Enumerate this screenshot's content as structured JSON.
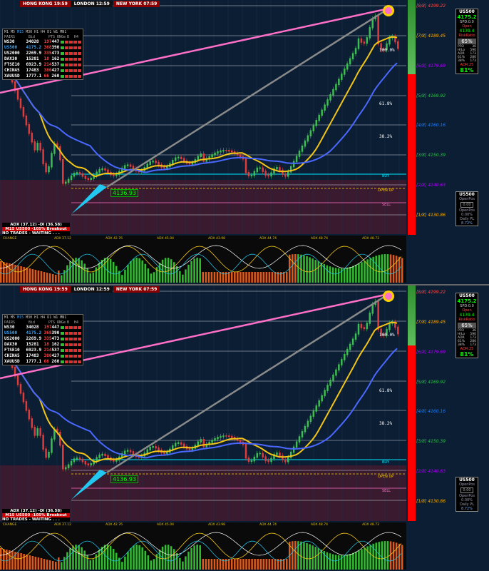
{
  "session_bar": {
    "hong_kong": "HONG KONG 19:59",
    "london": "LONDON 12:59",
    "new_york": "NEW YORK 07:59"
  },
  "quotes_table": {
    "timeframes": [
      "M1",
      "M5",
      "M15",
      "M30",
      "H1",
      "H4",
      "D1",
      "W1",
      "MN1"
    ],
    "headers": {
      "pairs": "PAIRS",
      "bid": "Bid",
      "pts": "PTS",
      "rng": "RNGe",
      "b": "B",
      "h": "H4"
    },
    "rows": [
      {
        "symbol": "WS30",
        "bid": "34028",
        "c1": "197",
        "c2": "447",
        "color": "#ffffff"
      },
      {
        "symbol": "US500",
        "bid": "4175.2",
        "c1": "368",
        "c2": "390",
        "color": "#3fa9ff"
      },
      {
        "symbol": "US2000",
        "bid": "2269.9",
        "c1": "335",
        "c2": "473",
        "color": "#ffffff"
      },
      {
        "symbol": "DAX30",
        "bid": "15281",
        "c1": "18",
        "c2": "162",
        "color": "#ffffff"
      },
      {
        "symbol": "FTSE10",
        "bid": "6923.9",
        "c1": "214",
        "c2": "537",
        "color": "#ffffff"
      },
      {
        "symbol": "CHINA5",
        "bid": "17483",
        "c1": "380",
        "c2": "427",
        "color": "#ffffff"
      },
      {
        "symbol": "XAUUSD",
        "bid": "1777.1",
        "c1": "66",
        "c2": "260",
        "color": "#ffffff"
      }
    ]
  },
  "fib_levels": [
    {
      "label": "[8/8]",
      "price": "4199.22",
      "color": "#ff4d4d"
    },
    {
      "label": "[7/8]",
      "price": "4189.45",
      "color": "#ffb000"
    },
    {
      "label": "[6/8]",
      "price": "4179.69",
      "color": "#b000ff"
    },
    {
      "label": "[5/8]",
      "price": "4169.92",
      "color": "#2fbf4f"
    },
    {
      "label": "[4/8]",
      "price": "4160.16",
      "color": "#1f7fff"
    },
    {
      "label": "[3/8]",
      "price": "4150.39",
      "color": "#2fbf4f"
    },
    {
      "label": "[2/8]",
      "price": "4140.63",
      "color": "#b000ff"
    },
    {
      "label": "[1/8]",
      "price": "4130.86",
      "color": "#ffb000"
    }
  ],
  "retracements": [
    "100.0%",
    "61.8%",
    "38.2%"
  ],
  "level_labels": {
    "buy": "BUY",
    "open_up": "OPEN UP",
    "sell": "SELL"
  },
  "entry_price": "4136.93",
  "info_panel": {
    "symbol": "US500",
    "price": "4175.2",
    "spread": "SPD:0.0",
    "open_label": "Open",
    "open_value": "4139.4",
    "risk_label": "RiskRatio",
    "risk_value": "65%",
    "stats": [
      [
        "PFO",
        "36"
      ],
      [
        "H/Lo",
        "590"
      ],
      [
        "ADR",
        "173"
      ],
      [
        "61%",
        "280"
      ],
      [
        "38%",
        "173"
      ]
    ],
    "adr_label": "ADR:25",
    "adr_value": "81%"
  },
  "pos_panel": {
    "symbol": "US500",
    "open_pos": "OpenPos",
    "open_pos_val": "0.00",
    "open_pos2": "OpenPos",
    "open_pos2_val": "0.00%",
    "daily": "Daily PL",
    "daily_val": "8.72%"
  },
  "adx_box": {
    "line1": "ADX (37.12) -DI (36.58)",
    "line2": "M15 US500 -105% Breakout",
    "line3": "NO TRADES - WAITING . . ."
  },
  "osc_labels": [
    "CHANGE",
    "ADX 37.12",
    "ADX 42.76",
    "ADX 45.04",
    "ADX 43.98",
    "ADX 44.74",
    "ADX 48.74",
    "ADX 48.73"
  ],
  "osc_sub": [
    "CHANGE",
    "STRONGER",
    "WEAKER",
    "STRONGER",
    "WEAKER",
    "STRONGER",
    "STRONGER"
  ],
  "colors": {
    "bg": "#0b1e33",
    "bull": "#3dbd52",
    "bear": "#e23a3a",
    "ma_yellow": "#f3c515",
    "ma_blue": "#4a68ff",
    "ma_pink": "#ff6ec7",
    "ma_gray": "#8a8a8a"
  },
  "chart_data": {
    "type": "line",
    "title": "",
    "price_levels": {
      "max": 4199.22,
      "min": 4130.86
    },
    "series": [
      {
        "name": "",
        "values": []
      }
    ]
  }
}
